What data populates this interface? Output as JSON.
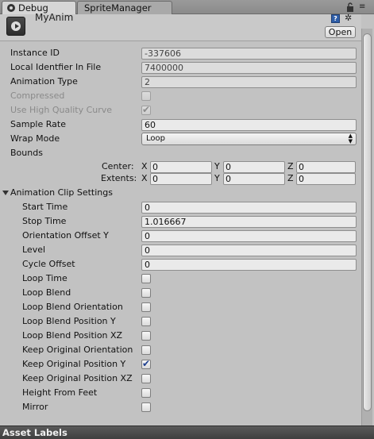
{
  "tabs": [
    {
      "label": "Debug",
      "active": true
    },
    {
      "label": "SpriteManager",
      "active": false
    }
  ],
  "header": {
    "asset_name": "MyAnim",
    "open_label": "Open",
    "help_glyph": "?"
  },
  "fields": {
    "instance_id": {
      "label": "Instance ID",
      "value": "-337606"
    },
    "local_identifier": {
      "label": "Local Identfier In File",
      "value": "7400000"
    },
    "animation_type": {
      "label": "Animation Type",
      "value": "2"
    },
    "compressed": {
      "label": "Compressed",
      "checked": false
    },
    "use_high_quality_curve": {
      "label": "Use High Quality Curve",
      "checked": true
    },
    "sample_rate": {
      "label": "Sample Rate",
      "value": "60"
    },
    "wrap_mode": {
      "label": "Wrap Mode",
      "value": "Loop"
    },
    "bounds": {
      "label": "Bounds"
    }
  },
  "bounds": {
    "center": {
      "label": "Center:",
      "x": "0",
      "y": "0",
      "z": "0"
    },
    "extents": {
      "label": "Extents:",
      "x": "0",
      "y": "0",
      "z": "0"
    },
    "axis_x": "X",
    "axis_y": "Y",
    "axis_z": "Z"
  },
  "clip_settings": {
    "label": "Animation Clip Settings",
    "start_time": {
      "label": "Start Time",
      "value": "0"
    },
    "stop_time": {
      "label": "Stop Time",
      "value": "1.016667"
    },
    "orientation_offset_y": {
      "label": "Orientation Offset Y",
      "value": "0"
    },
    "level": {
      "label": "Level",
      "value": "0"
    },
    "cycle_offset": {
      "label": "Cycle Offset",
      "value": "0"
    },
    "toggles": [
      {
        "label": "Loop Time",
        "checked": false
      },
      {
        "label": "Loop Blend",
        "checked": false
      },
      {
        "label": "Loop Blend Orientation",
        "checked": false
      },
      {
        "label": "Loop Blend Position Y",
        "checked": false
      },
      {
        "label": "Loop Blend Position XZ",
        "checked": false
      },
      {
        "label": "Keep Original Orientation",
        "checked": false
      },
      {
        "label": "Keep Original Position Y",
        "checked": true
      },
      {
        "label": "Keep Original Position XZ",
        "checked": false
      },
      {
        "label": "Height From Feet",
        "checked": false
      },
      {
        "label": "Mirror",
        "checked": false
      }
    ]
  },
  "footer": {
    "label": "Asset Labels"
  },
  "icons": {
    "check_glyph": "✔",
    "select_arrows": "▲▼",
    "menu_glyph": "≡",
    "settings_glyph": "✲"
  },
  "colors": {
    "background": "#c2c2c2",
    "check": "#1e3f8f",
    "footer": "#4a4a4a"
  }
}
